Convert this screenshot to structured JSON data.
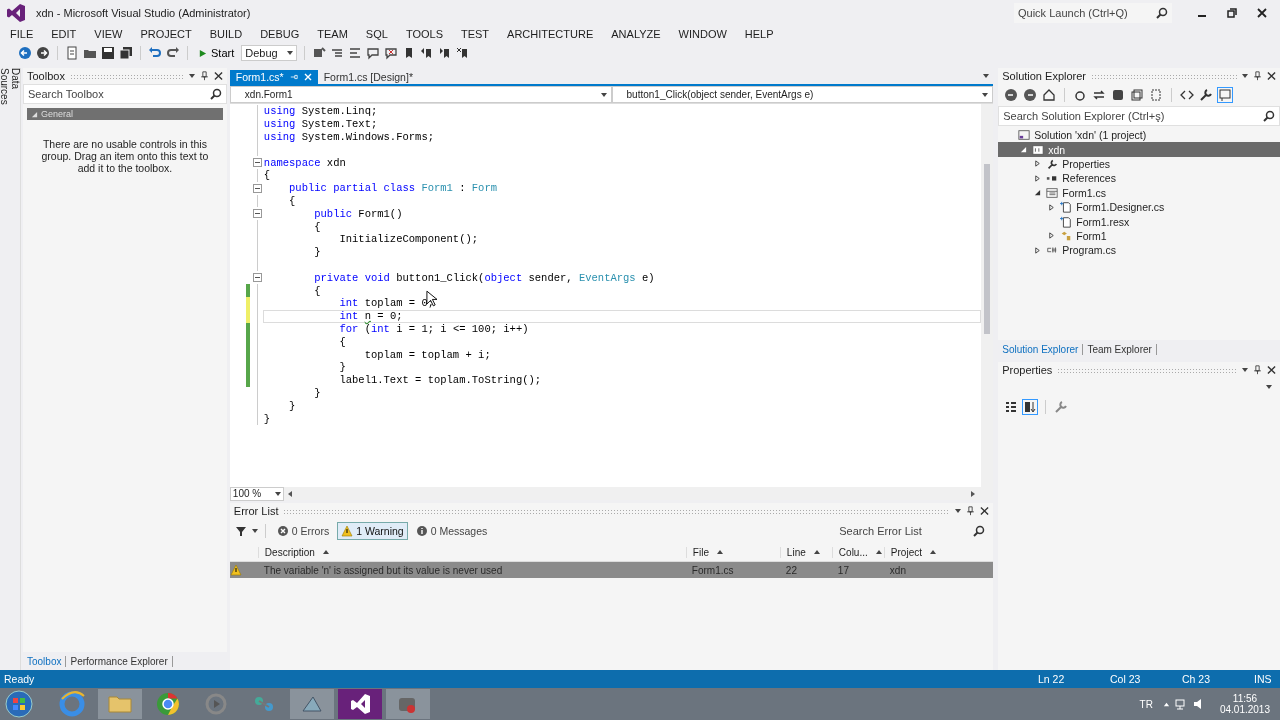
{
  "window": {
    "title": "xdn - Microsoft Visual Studio (Administrator)",
    "quick_launch": {
      "placeholder": "Quick Launch (Ctrl+Q)"
    }
  },
  "menu": [
    "FILE",
    "EDIT",
    "VIEW",
    "PROJECT",
    "BUILD",
    "DEBUG",
    "TEAM",
    "SQL",
    "TOOLS",
    "TEST",
    "ARCHITECTURE",
    "ANALYZE",
    "WINDOW",
    "HELP"
  ],
  "toolbar": {
    "start": "Start",
    "configuration": "Debug"
  },
  "side_strip": {
    "label": "Data Sources"
  },
  "toolbox": {
    "title": "Toolbox",
    "search": {
      "placeholder": "Search Toolbox"
    },
    "group": {
      "label": "General",
      "expanded": true
    },
    "message": "There are no usable controls in this group. Drag an item onto this text to add it to the toolbox.",
    "tabs": [
      {
        "label": "Toolbox",
        "selected": true
      },
      {
        "label": "Performance Explorer",
        "selected": false
      }
    ]
  },
  "editor": {
    "tabs": [
      {
        "label": "Form1.cs*",
        "selected": true
      },
      {
        "label": "Form1.cs [Design]*",
        "selected": false
      }
    ],
    "type_dropdown": "xdn.Form1",
    "member_dropdown": "button1_Click(object sender, EventArgs e)",
    "zoom": "100 %",
    "lines": [
      {
        "tokens": [
          {
            "text": "using ",
            "kind": "keyword"
          },
          {
            "text": "System.Linq;",
            "kind": "plain"
          }
        ],
        "fold": false,
        "current": false
      },
      {
        "tokens": [
          {
            "text": "using ",
            "kind": "keyword"
          },
          {
            "text": "System.Text;",
            "kind": "plain"
          }
        ],
        "fold": false,
        "current": false
      },
      {
        "tokens": [
          {
            "text": "using ",
            "kind": "keyword"
          },
          {
            "text": "System.Windows.Forms;",
            "kind": "plain"
          }
        ],
        "fold": false,
        "current": false
      },
      {
        "fold": false,
        "current": false
      },
      {
        "tokens": [
          {
            "text": "namespace ",
            "kind": "keyword"
          },
          {
            "text": "xdn",
            "kind": "plain"
          }
        ],
        "fold": true,
        "current": false
      },
      {
        "tokens": [
          {
            "text": "{",
            "kind": "plain"
          }
        ],
        "fold": false,
        "current": false
      },
      {
        "tokens": [
          {
            "text": "    public partial class ",
            "kind": "keyword"
          },
          {
            "text": "Form1",
            "kind": "type"
          },
          {
            "text": " : ",
            "kind": "plain"
          },
          {
            "text": "Form",
            "kind": "type"
          }
        ],
        "fold": true,
        "current": false
      },
      {
        "tokens": [
          {
            "text": "    {",
            "kind": "plain"
          }
        ],
        "fold": false,
        "current": false
      },
      {
        "tokens": [
          {
            "text": "        public ",
            "kind": "keyword"
          },
          {
            "text": "Form1()",
            "kind": "plain"
          }
        ],
        "fold": true,
        "current": false
      },
      {
        "tokens": [
          {
            "text": "        {",
            "kind": "plain"
          }
        ],
        "fold": false,
        "current": false
      },
      {
        "tokens": [
          {
            "text": "            InitializeComponent();",
            "kind": "plain"
          }
        ],
        "fold": false,
        "current": false
      },
      {
        "tokens": [
          {
            "text": "        }",
            "kind": "plain"
          }
        ],
        "fold": false,
        "current": false
      },
      {
        "fold": false,
        "current": false
      },
      {
        "tokens": [
          {
            "text": "        private void ",
            "kind": "keyword"
          },
          {
            "text": "button1_Click(",
            "kind": "plain"
          },
          {
            "text": "object ",
            "kind": "keyword"
          },
          {
            "text": "sender, ",
            "kind": "plain"
          },
          {
            "text": "EventArgs",
            "kind": "type"
          },
          {
            "text": " e)",
            "kind": "plain"
          }
        ],
        "fold": true,
        "current": false
      },
      {
        "tokens": [
          {
            "text": "        {",
            "kind": "plain"
          }
        ],
        "fold": false,
        "current": false,
        "kind": "saved_change"
      },
      {
        "tokens": [
          {
            "text": "            int ",
            "kind": "keyword"
          },
          {
            "text": "toplam = 0;",
            "kind": "plain"
          }
        ],
        "fold": false,
        "current": false,
        "kind": "unsaved_change"
      },
      {
        "tokens": [
          {
            "text": "            int ",
            "kind": "keyword"
          },
          {
            "text": "n",
            "kind": "warning"
          },
          {
            "text": " = 0;",
            "kind": "plain"
          }
        ],
        "fold": false,
        "current": true,
        "kind": "unsaved_change"
      },
      {
        "tokens": [
          {
            "text": "            for ",
            "kind": "keyword"
          },
          {
            "text": "(",
            "kind": "plain"
          },
          {
            "text": "int ",
            "kind": "keyword"
          },
          {
            "text": "i = 1; i <= 100; i++)",
            "kind": "plain"
          }
        ],
        "fold": false,
        "current": false,
        "kind": "saved_change"
      },
      {
        "tokens": [
          {
            "text": "            {",
            "kind": "plain"
          }
        ],
        "fold": false,
        "current": false,
        "kind": "saved_change"
      },
      {
        "tokens": [
          {
            "text": "                toplam = toplam + i;",
            "kind": "plain"
          }
        ],
        "fold": false,
        "current": false,
        "kind": "saved_change"
      },
      {
        "tokens": [
          {
            "text": "            }",
            "kind": "plain"
          }
        ],
        "fold": false,
        "current": false,
        "kind": "saved_change"
      },
      {
        "tokens": [
          {
            "text": "            label1.Text = toplam.ToString();",
            "kind": "plain"
          }
        ],
        "fold": false,
        "current": false,
        "kind": "saved_change"
      },
      {
        "tokens": [
          {
            "text": "        }",
            "kind": "plain"
          }
        ],
        "fold": false,
        "current": false
      },
      {
        "tokens": [
          {
            "text": "    }",
            "kind": "plain"
          }
        ],
        "fold": false,
        "current": false
      },
      {
        "tokens": [
          {
            "text": "}",
            "kind": "plain"
          }
        ],
        "fold": false,
        "current": false
      }
    ]
  },
  "error_list": {
    "title": "Error List",
    "filters": [
      {
        "label": "0 Errors",
        "kind": "error",
        "selected": false
      },
      {
        "label": "1 Warning",
        "kind": "warning",
        "selected": true
      },
      {
        "label": "0 Messages",
        "kind": "info",
        "selected": false
      }
    ],
    "search": {
      "placeholder": "Search Error List"
    },
    "columns": [
      "Description",
      "File",
      "Line",
      "Colu...",
      "Project"
    ],
    "rows": [
      {
        "kind": "warning",
        "selected": true,
        "cells": [
          "The variable 'n' is assigned but its value is never used",
          "Form1.cs",
          "22",
          "17",
          "xdn"
        ]
      }
    ]
  },
  "solution_explorer": {
    "title": "Solution Explorer",
    "search": {
      "placeholder": "Search Solution Explorer (Ctrl+ş)"
    },
    "tree": [
      {
        "label": "Solution 'xdn' (1 project)",
        "kind": "solution",
        "selected": false,
        "children": [
          {
            "label": "xdn",
            "kind": "project",
            "selected": true,
            "expanded": true,
            "children": [
              {
                "label": "Properties",
                "kind": "properties",
                "selected": false,
                "expanded": false
              },
              {
                "label": "References",
                "kind": "references",
                "selected": false,
                "expanded": false
              },
              {
                "label": "Form1.cs",
                "kind": "form",
                "selected": false,
                "expanded": true,
                "children": [
                  {
                    "label": "Form1.Designer.cs",
                    "kind": "file",
                    "selected": false,
                    "expanded": false
                  },
                  {
                    "label": "Form1.resx",
                    "kind": "file",
                    "selected": false
                  },
                  {
                    "label": "Form1",
                    "kind": "class",
                    "selected": false,
                    "expanded": false
                  }
                ]
              },
              {
                "label": "Program.cs",
                "kind": "code",
                "selected": false,
                "expanded": false
              }
            ]
          }
        ]
      }
    ],
    "tabs": [
      {
        "label": "Solution Explorer",
        "selected": true
      },
      {
        "label": "Team Explorer",
        "selected": false
      }
    ]
  },
  "properties": {
    "title": "Properties"
  },
  "status_bar": {
    "status": "Ready",
    "line": "Ln 22",
    "column": "Col 23",
    "char": "Ch 23",
    "mode": "INS"
  },
  "taskbar": {
    "language": "TR",
    "time": "11:56",
    "date": "04.01.2013"
  }
}
